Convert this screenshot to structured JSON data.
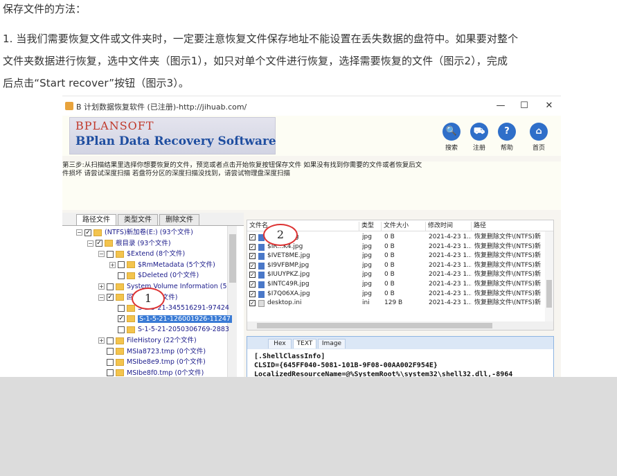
{
  "article": {
    "heading": "保存文件的方法：",
    "lines": [
      "1. 当我们需要恢复文件或文件夹时，一定要注意恢复文件保存地址不能设置在丢失数据的盘符中。如果要对整个",
      "文件夹数据进行恢复，选中文件夹（图示1），如只对单个文件进行恢复，选择需要恢复的文件（图示2），完成",
      "后点击“Start recover”按钮（图示3）。"
    ]
  },
  "window": {
    "title": "B 计划数据恢复软件 (已注册)-http://jihuab.com/",
    "minimize": "—",
    "maximize": "☐",
    "close": "✕"
  },
  "logo": {
    "small": "BPLANSOFT",
    "big": "BPlan Data Recovery Software"
  },
  "nav": [
    {
      "label": "搜索",
      "icon": "search-icon",
      "glyph": "🔍",
      "color": "#2f6fc9"
    },
    {
      "label": "注册",
      "icon": "cart-icon",
      "glyph": "⛟",
      "color": "#2f6fc9"
    },
    {
      "label": "帮助",
      "icon": "help-icon",
      "glyph": "?",
      "color": "#2f6fc9"
    },
    {
      "label": "首页",
      "icon": "home-icon",
      "glyph": "⌂",
      "color": "#2f6fc9"
    }
  ],
  "instruction": [
    "第三步:从扫描结果里选择你想要恢复的文件，预览或者点击开始恢复按钮保存文件 如果没有找到你需要的文件或者恢复后文",
    "件损坏 请尝试深度扫描 若盘符分区的深度扫描没找到，请尝试物理盘深度扫描"
  ],
  "tabs": [
    "路径文件",
    "类型文件",
    "删除文件"
  ],
  "tree": [
    {
      "label": "(NTFS)新加卷(E:) (93个文件)",
      "exp": "−",
      "check": "✓",
      "indent": 20
    },
    {
      "label": "根目录 (93个文件)",
      "exp": "−",
      "check": "✓",
      "indent": 36
    },
    {
      "label": "$Extend (8个文件)",
      "exp": "−",
      "check": "",
      "indent": 52
    },
    {
      "label": "$RmMetadata (5个文件)",
      "exp": "+",
      "check": "",
      "indent": 68
    },
    {
      "label": "$Deleted (0个文件)",
      "exp": "",
      "check": "",
      "indent": 68
    },
    {
      "label": "System Volume Information (5",
      "exp": "+",
      "check": "",
      "indent": 52
    },
    {
      "label": "回收站 (5个文件)",
      "exp": "−",
      "check": "✓",
      "indent": 52
    },
    {
      "label": "S-1-5-21-345516291-97424",
      "exp": "",
      "check": "",
      "indent": 68
    },
    {
      "label": "S-1-5-21-126001926-11247",
      "exp": "",
      "check": "✓",
      "indent": 68,
      "selected": true
    },
    {
      "label": "S-1-5-21-2050306769-2883",
      "exp": "",
      "check": "",
      "indent": 68
    },
    {
      "label": "FileHistory (22个文件)",
      "exp": "+",
      "check": "",
      "indent": 52
    },
    {
      "label": "MSIa8723.tmp (0个文件)",
      "exp": "",
      "check": "",
      "indent": 52
    },
    {
      "label": "MSIbe8e9.tmp (0个文件)",
      "exp": "",
      "check": "",
      "indent": 52
    },
    {
      "label": "MSIbe8f0.tmp (0个文件)",
      "exp": "",
      "check": "",
      "indent": 52
    }
  ],
  "filelist": {
    "columns": [
      "文件名",
      "类型",
      "文件大小",
      "修改时间",
      "路径"
    ],
    "rows": [
      {
        "name": "$IR...4.jpg",
        "type": "jpg",
        "size": "0 B",
        "time": "2021-4-23 1...",
        "path": "恢复删除文件\\(NTFS)新",
        "icon": "jpg"
      },
      {
        "name": "$IR...K4.jpg",
        "type": "jpg",
        "size": "0 B",
        "time": "2021-4-23 1...",
        "path": "恢复删除文件\\(NTFS)新",
        "icon": "jpg"
      },
      {
        "name": "$IVET8ME.jpg",
        "type": "jpg",
        "size": "0 B",
        "time": "2021-4-23 1...",
        "path": "恢复删除文件\\(NTFS)新",
        "icon": "jpg"
      },
      {
        "name": "$I9VFBMP.jpg",
        "type": "jpg",
        "size": "0 B",
        "time": "2021-4-23 1...",
        "path": "恢复删除文件\\(NTFS)新",
        "icon": "jpg"
      },
      {
        "name": "$IUUYPKZ.jpg",
        "type": "jpg",
        "size": "0 B",
        "time": "2021-4-23 1...",
        "path": "恢复删除文件\\(NTFS)新",
        "icon": "jpg"
      },
      {
        "name": "$INTC49R.jpg",
        "type": "jpg",
        "size": "0 B",
        "time": "2021-4-23 1...",
        "path": "恢复删除文件\\(NTFS)新",
        "icon": "jpg"
      },
      {
        "name": "$I7Q06XA.jpg",
        "type": "jpg",
        "size": "0 B",
        "time": "2021-4-23 1...",
        "path": "恢复删除文件\\(NTFS)新",
        "icon": "jpg"
      },
      {
        "name": "desktop.ini",
        "type": "ini",
        "size": "129 B",
        "time": "2021-4-23 1...",
        "path": "恢复删除文件\\(NTFS)新",
        "icon": "ini"
      }
    ]
  },
  "preview": {
    "tabs": [
      "Hex",
      "TEXT",
      "Image"
    ],
    "lines": [
      "[.ShellClassInfo]",
      "CLSID={645FF040-5081-101B-9F08-00AA002F954E}",
      "LocalizedResourceName=@%SystemRoot%\\system32\\shell32.dll,-8964"
    ]
  },
  "callouts": [
    "1",
    "2"
  ]
}
